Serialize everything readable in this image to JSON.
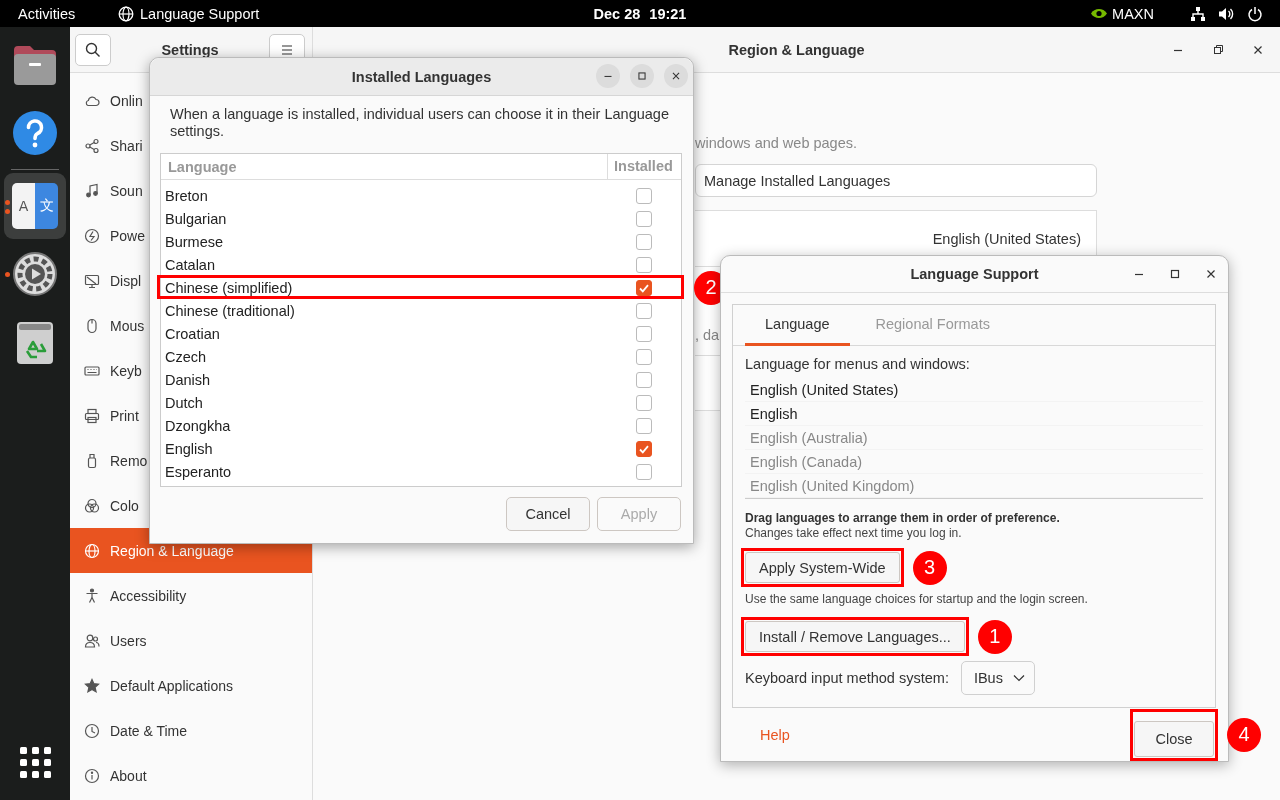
{
  "top_bar": {
    "activities": "Activities",
    "app_name": "Language Support",
    "date": "Dec 28",
    "time": "19:21",
    "gpu_mode": "MAXN"
  },
  "dock": {
    "items": [
      {
        "kind": "files",
        "selected": false,
        "running": false,
        "multiple_windows": false
      },
      {
        "kind": "help",
        "selected": false,
        "running": false,
        "multiple_windows": false
      },
      {
        "kind": "language",
        "selected": true,
        "running": true,
        "multiple_windows": true,
        "glyph_left": "A",
        "glyph_right": "文"
      },
      {
        "kind": "settings",
        "selected": false,
        "running": true,
        "multiple_windows": false
      },
      {
        "kind": "trash",
        "selected": false,
        "running": false,
        "multiple_windows": false
      }
    ]
  },
  "settings": {
    "title": "Settings",
    "sidebar": [
      {
        "label": "Onlin",
        "kind": "cloud",
        "selected": false
      },
      {
        "label": "Shari",
        "kind": "share",
        "selected": false
      },
      {
        "label": "Soun",
        "kind": "music",
        "selected": false
      },
      {
        "label": "Powe",
        "kind": "power",
        "selected": false
      },
      {
        "label": "Displ",
        "kind": "display",
        "selected": false
      },
      {
        "label": "Mous",
        "kind": "mouse",
        "selected": false
      },
      {
        "label": "Keyb",
        "kind": "keyboard",
        "selected": false
      },
      {
        "label": "Print",
        "kind": "printer",
        "selected": false
      },
      {
        "label": "Remo",
        "kind": "removable",
        "selected": false
      },
      {
        "label": "Colo",
        "kind": "color",
        "selected": false
      },
      {
        "label": "Region & Language",
        "kind": "globe",
        "selected": true
      },
      {
        "label": "Accessibility",
        "kind": "accessibility",
        "selected": false
      },
      {
        "label": "Users",
        "kind": "users",
        "selected": false
      },
      {
        "label": "Default Applications",
        "kind": "star",
        "selected": false
      },
      {
        "label": "Date & Time",
        "kind": "clock",
        "selected": false
      },
      {
        "label": "About",
        "kind": "info",
        "selected": false
      }
    ],
    "page_title": "Region & Language",
    "description": "windows and web pages.",
    "manage_button": "Manage Installed Languages",
    "language_value": "English (United States)",
    "formats_fragment": ", da"
  },
  "installed_languages": {
    "title": "Installed Languages",
    "description": "When a language is installed, individual users can choose it in their Language settings.",
    "columns": [
      "Language",
      "Installed"
    ],
    "rows": [
      {
        "name": "Breton",
        "checked": false,
        "highlighted": false
      },
      {
        "name": "Bulgarian",
        "checked": false,
        "highlighted": false
      },
      {
        "name": "Burmese",
        "checked": false,
        "highlighted": false
      },
      {
        "name": "Catalan",
        "checked": false,
        "highlighted": false
      },
      {
        "name": "Chinese (simplified)",
        "checked": true,
        "highlighted": true,
        "callout": "2"
      },
      {
        "name": "Chinese (traditional)",
        "checked": false,
        "highlighted": false
      },
      {
        "name": "Croatian",
        "checked": false,
        "highlighted": false
      },
      {
        "name": "Czech",
        "checked": false,
        "highlighted": false
      },
      {
        "name": "Danish",
        "checked": false,
        "highlighted": false
      },
      {
        "name": "Dutch",
        "checked": false,
        "highlighted": false
      },
      {
        "name": "Dzongkha",
        "checked": false,
        "highlighted": false
      },
      {
        "name": "English",
        "checked": true,
        "highlighted": false
      },
      {
        "name": "Esperanto",
        "checked": false,
        "highlighted": false
      }
    ],
    "buttons": [
      {
        "label": "Cancel",
        "disabled": false
      },
      {
        "label": "Apply",
        "disabled": true
      }
    ]
  },
  "language_support": {
    "title": "Language Support",
    "tabs": [
      {
        "label": "Language",
        "selected": true
      },
      {
        "label": "Regional Formats",
        "selected": false
      }
    ],
    "list_label": "Language for menus and windows:",
    "languages": [
      {
        "name": "English (United States)",
        "dimmed": false
      },
      {
        "name": "English",
        "dimmed": false
      },
      {
        "name": "English (Australia)",
        "dimmed": true
      },
      {
        "name": "English (Canada)",
        "dimmed": true
      },
      {
        "name": "English (United Kingdom)",
        "dimmed": true
      }
    ],
    "drag_hint": "Drag languages to arrange them in order of preference.",
    "drag_note": "Changes take effect next time you log in.",
    "apply_button": {
      "label": "Apply System-Wide",
      "highlighted": true,
      "callout": "3"
    },
    "apply_note": "Use the same language choices for startup and the login screen.",
    "install_button": {
      "label": "Install / Remove Languages...",
      "highlighted": true,
      "callout": "1"
    },
    "input_method": {
      "label": "Keyboard input method system:",
      "value": "IBus"
    },
    "help": "Help",
    "close_button": {
      "label": "Close",
      "highlighted": true,
      "callout": "4"
    }
  }
}
